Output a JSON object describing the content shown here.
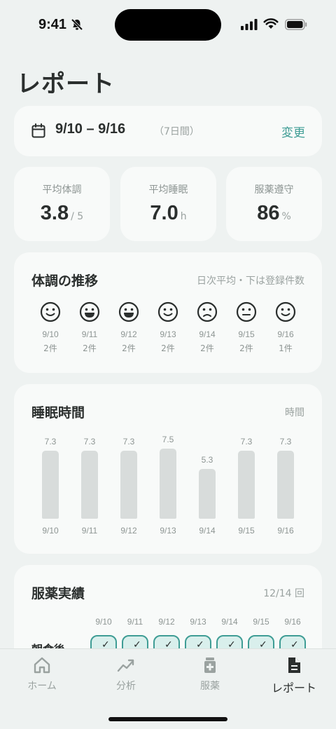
{
  "status_bar": {
    "time": "9:41"
  },
  "page": {
    "title": "レポート"
  },
  "period": {
    "range": "9/10 – 9/16",
    "days": "（7日間）",
    "change": "変更"
  },
  "stats": [
    {
      "label": "平均体調",
      "value": "3.8",
      "unit": "/ 5"
    },
    {
      "label": "平均睡眠",
      "value": "7.0",
      "unit": "h"
    },
    {
      "label": "服薬遵守",
      "value": "86",
      "unit": "%"
    }
  ],
  "condition": {
    "title": "体調の推移",
    "note": "日次平均・下は登録件数",
    "days": [
      {
        "date": "9/10",
        "count": "2件",
        "mood": "smile"
      },
      {
        "date": "9/11",
        "count": "2件",
        "mood": "grin"
      },
      {
        "date": "9/12",
        "count": "2件",
        "mood": "grin"
      },
      {
        "date": "9/13",
        "count": "2件",
        "mood": "smile"
      },
      {
        "date": "9/14",
        "count": "2件",
        "mood": "frown"
      },
      {
        "date": "9/15",
        "count": "2件",
        "mood": "neutral"
      },
      {
        "date": "9/16",
        "count": "1件",
        "mood": "smile"
      }
    ]
  },
  "sleep": {
    "title": "睡眠時間",
    "unit_note": "時間"
  },
  "chart_data": {
    "type": "bar",
    "categories": [
      "9/10",
      "9/11",
      "9/12",
      "9/13",
      "9/14",
      "9/15",
      "9/16"
    ],
    "values": [
      7.3,
      7.3,
      7.3,
      7.5,
      5.3,
      7.3,
      7.3
    ],
    "value_labels": [
      "7.3",
      "7.3",
      "7.3",
      "7.5",
      "5.3",
      "7.3",
      "7.3"
    ],
    "title": "睡眠時間",
    "ylabel": "時間",
    "ylim": [
      0,
      7.5
    ],
    "grid": false
  },
  "medication": {
    "title": "服薬実績",
    "summary": "12/14 回",
    "dates": [
      "9/10",
      "9/11",
      "9/12",
      "9/13",
      "9/14",
      "9/15",
      "9/16"
    ],
    "rows": [
      {
        "label": "朝食後",
        "checks": [
          "✓",
          "✓",
          "✓",
          "✓",
          "✓",
          "✓",
          "✓"
        ]
      }
    ]
  },
  "tabs": [
    {
      "label": "ホーム",
      "icon": "home-icon",
      "active": false
    },
    {
      "label": "分析",
      "icon": "trend-icon",
      "active": false
    },
    {
      "label": "服薬",
      "icon": "medicine-icon",
      "active": false
    },
    {
      "label": "レポート",
      "icon": "document-icon",
      "active": true
    }
  ],
  "colors": {
    "accent": "#3f9d95",
    "bar": "#d8dcdb",
    "background": "#eef2f1",
    "card": "#f8faf9"
  }
}
